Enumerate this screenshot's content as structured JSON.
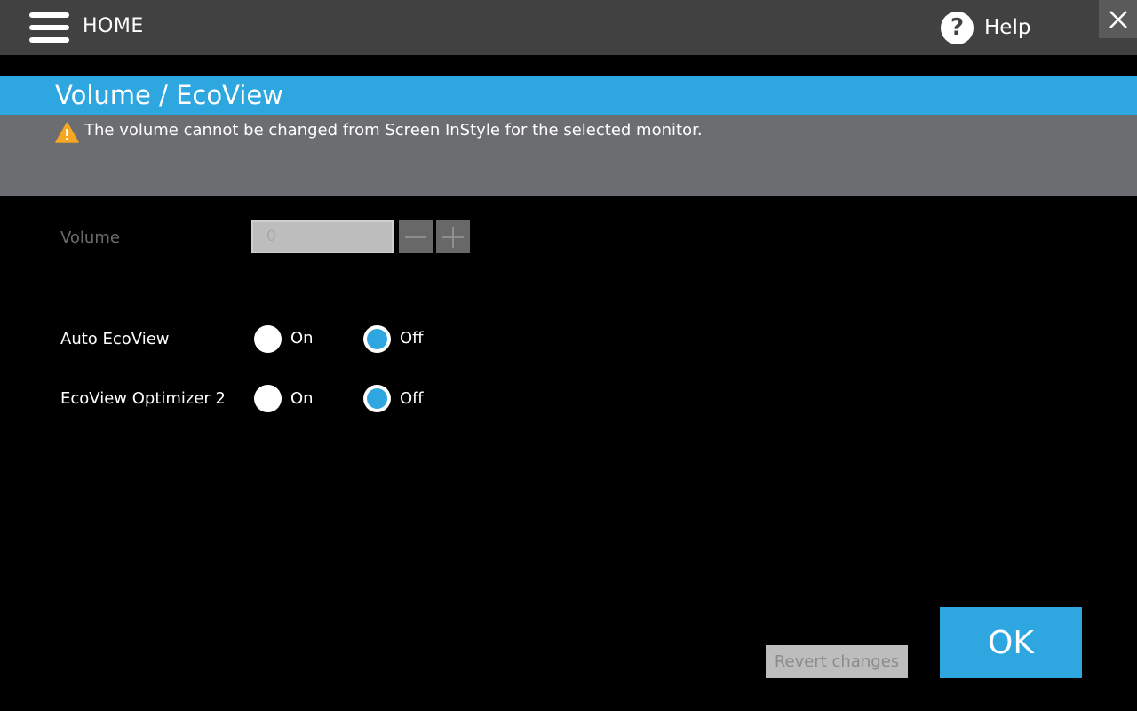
{
  "header": {
    "home_label": "HOME",
    "help_label": "Help",
    "help_icon_glyph": "?",
    "menu_icon": "hamburger-menu-icon",
    "close_icon": "close-icon"
  },
  "page": {
    "title": "Volume / EcoView",
    "notice": "The volume cannot be changed from Screen InStyle for the selected monitor.",
    "notice_icon": "warning-icon"
  },
  "volume": {
    "label": "Volume",
    "value": "0"
  },
  "settings": [
    {
      "label": "Auto EcoView",
      "on_label": "On",
      "off_label": "Off",
      "selected": "Off"
    },
    {
      "label": "EcoView Optimizer 2",
      "on_label": "On",
      "off_label": "Off",
      "selected": "Off"
    }
  ],
  "footer": {
    "revert_label": "Revert changes",
    "ok_label": "OK"
  },
  "colors": {
    "accent": "#2ea7e0",
    "header_bg": "#414141",
    "notice_bg": "#6b6d70",
    "warning": "#f5a623"
  }
}
